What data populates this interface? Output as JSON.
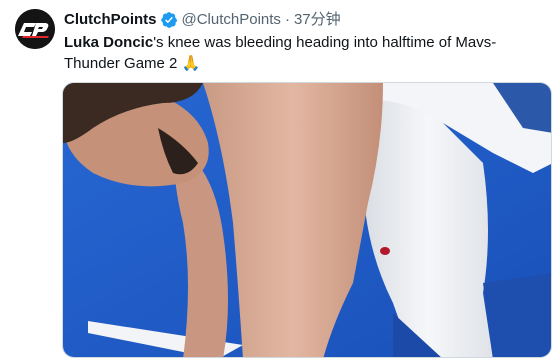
{
  "tweet": {
    "display_name": "ClutchPoints",
    "handle": "@ClutchPoints",
    "separator": "·",
    "time": "37分钟",
    "text_bold": "Luka Doncic",
    "text_rest": "'s knee was bleeding heading into halftime of Mavs-Thunder Game 2 🙏",
    "avatar_logo": "CP",
    "verified_icon": "verified-badge-icon",
    "media_description_icon": "photo"
  },
  "colors": {
    "verified": "#1d9bf0",
    "court_blue": "#1f5ec9",
    "secondary_text": "#536471"
  }
}
